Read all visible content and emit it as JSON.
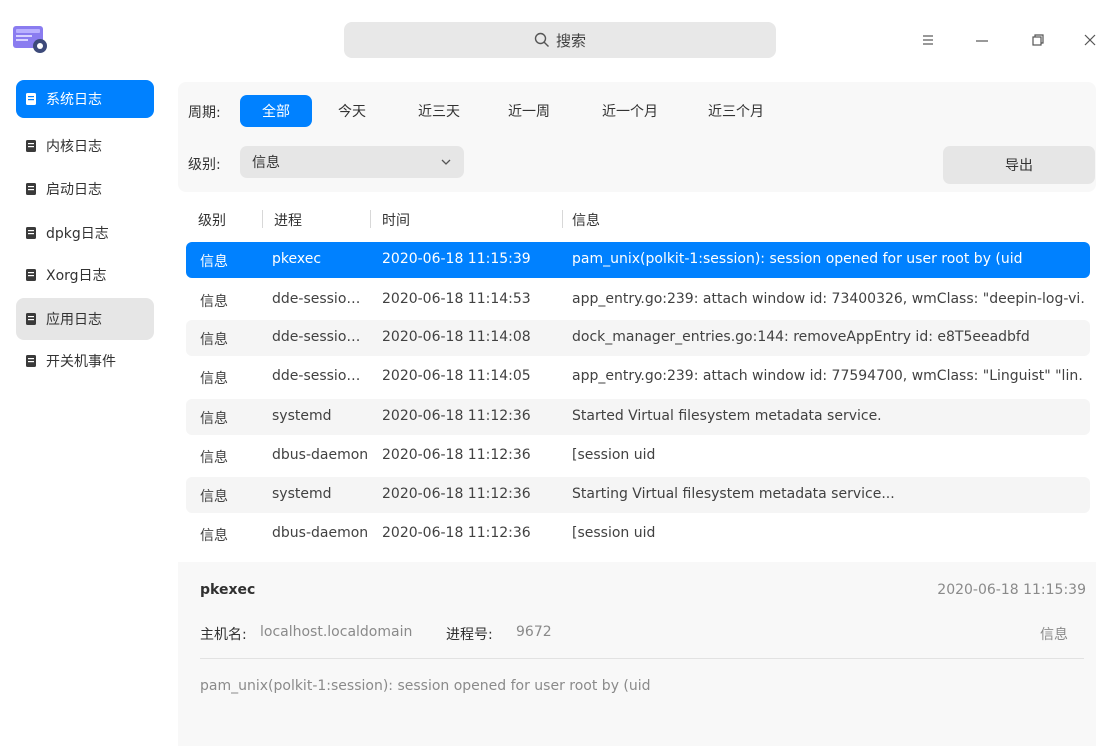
{
  "titlebar": {
    "search_placeholder": "搜索"
  },
  "sidebar": {
    "items": [
      {
        "label": "系统日志",
        "icon": "system-log-icon",
        "state": "active"
      },
      {
        "label": "内核日志",
        "icon": "kernel-log-icon",
        "state": ""
      },
      {
        "label": "启动日志",
        "icon": "boot-log-icon",
        "state": ""
      },
      {
        "label": "dpkg日志",
        "icon": "dpkg-log-icon",
        "state": ""
      },
      {
        "label": "Xorg日志",
        "icon": "xorg-log-icon",
        "state": ""
      },
      {
        "label": "应用日志",
        "icon": "app-log-icon",
        "state": "hover"
      },
      {
        "label": "开关机事件",
        "icon": "power-event-icon",
        "state": ""
      }
    ]
  },
  "filters": {
    "period_label": "周期:",
    "periods": [
      "全部",
      "今天",
      "近三天",
      "近一周",
      "近一个月",
      "近三个月"
    ],
    "active_period": "全部",
    "level_label": "级别:",
    "level_value": "信息",
    "export_label": "导出"
  },
  "table": {
    "headers": [
      "级别",
      "进程",
      "时间",
      "信息"
    ],
    "rows": [
      {
        "level": "信息",
        "process": "pkexec",
        "time": "2020-06-18 11:15:39",
        "message": "pam_unix(polkit-1:session): session opened for user root by (uid"
      },
      {
        "level": "信息",
        "process": "dde-sessio…",
        "time": "2020-06-18 11:14:53",
        "message": "app_entry.go:239: attach window id: 73400326, wmClass: \"deepin-log-vi…"
      },
      {
        "level": "信息",
        "process": "dde-sessio…",
        "time": "2020-06-18 11:14:08",
        "message": "dock_manager_entries.go:144: removeAppEntry id: e8T5eeadbfd"
      },
      {
        "level": "信息",
        "process": "dde-sessio…",
        "time": "2020-06-18 11:14:05",
        "message": "app_entry.go:239: attach window id: 77594700, wmClass: \"Linguist\" \"lin…"
      },
      {
        "level": "信息",
        "process": "systemd",
        "time": "2020-06-18 11:12:36",
        "message": "Started Virtual filesystem metadata service."
      },
      {
        "level": "信息",
        "process": "dbus-daemon",
        "time": "2020-06-18 11:12:36",
        "message": "[session uid"
      },
      {
        "level": "信息",
        "process": "systemd",
        "time": "2020-06-18 11:12:36",
        "message": "Starting Virtual filesystem metadata service..."
      },
      {
        "level": "信息",
        "process": "dbus-daemon",
        "time": "2020-06-18 11:12:36",
        "message": "[session uid"
      }
    ]
  },
  "detail": {
    "process": "pkexec",
    "time": "2020-06-18 11:15:39",
    "host_label": "主机名:",
    "host": "localhost.localdomain",
    "pid_label": "进程号:",
    "pid": "9672",
    "level": "信息",
    "message": "pam_unix(polkit-1:session): session opened for user root by (uid"
  },
  "colors": {
    "accent": "#0081ff"
  }
}
